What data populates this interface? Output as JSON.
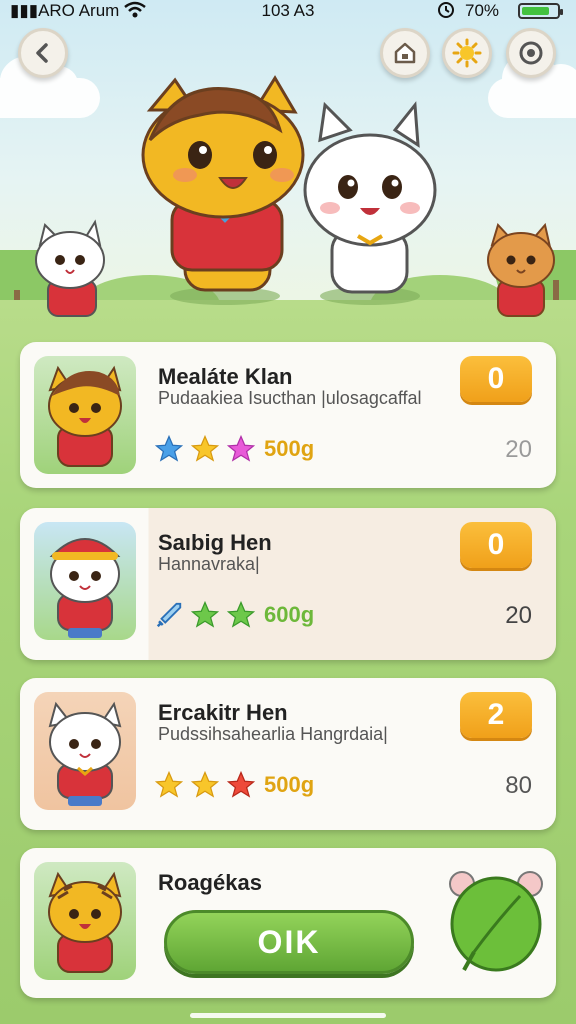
{
  "status_bar": {
    "carrier": "▮▮▮ARO Arum",
    "time": "103 A3",
    "battery_percent": "70%",
    "battery_level": 0.8
  },
  "toolbar": {
    "back_icon": "back-arrow-icon",
    "home_icon": "house-icon",
    "sun_icon": "sun-icon",
    "settings_icon": "ring-settings-icon"
  },
  "cards": [
    {
      "name": "Mealáte Klan",
      "subtitle": "Pudaakiea Isucthan |ulosagcaffal",
      "stars": [
        "blue",
        "gold",
        "pink"
      ],
      "weight": "500g",
      "weight_color": "#e0a412",
      "level": "0",
      "score": "20",
      "score_color": "#9a9a9a",
      "character": "yellow-cat"
    },
    {
      "name": "Saıbig Hen",
      "subtitle": "Hannavraka|",
      "stars": [
        "sword",
        "green",
        "green"
      ],
      "weight": "600g",
      "weight_color": "#6db83a",
      "level": "0",
      "score": "20",
      "score_color": "#444444",
      "character": "white-cat-cap"
    },
    {
      "name": "Ercakitr Hen",
      "subtitle": "Pudssihsahearlia Hangrdaia|",
      "stars": [
        "gold",
        "gold",
        "red"
      ],
      "weight": "500g",
      "weight_color": "#e0a412",
      "level": "2",
      "score": "80",
      "score_color": "#555555",
      "character": "white-cat"
    },
    {
      "name": "Roagékas",
      "button": "OIK",
      "character": "yellow-cat",
      "side_icon": "green-leaf-icon"
    }
  ],
  "colors": {
    "accent_orange": "#f5a623",
    "ok_green": "#6cb83c"
  }
}
